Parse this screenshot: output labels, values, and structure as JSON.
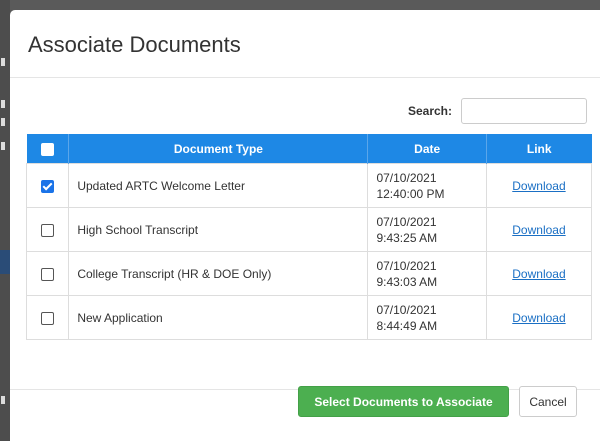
{
  "modal": {
    "title": "Associate Documents"
  },
  "search": {
    "label": "Search:",
    "value": "",
    "placeholder": ""
  },
  "table": {
    "headers": {
      "select_all_checked": false,
      "document_type": "Document Type",
      "date": "Date",
      "link": "Link"
    },
    "rows": [
      {
        "checked": true,
        "document_type": "Updated ARTC Welcome Letter",
        "date_line1": "07/10/2021",
        "date_line2": "12:40:00 PM",
        "link": "Download"
      },
      {
        "checked": false,
        "document_type": "High School Transcript",
        "date_line1": "07/10/2021",
        "date_line2": "9:43:25 AM",
        "link": "Download"
      },
      {
        "checked": false,
        "document_type": "College Transcript (HR & DOE Only)",
        "date_line1": "07/10/2021",
        "date_line2": "9:43:03 AM",
        "link": "Download"
      },
      {
        "checked": false,
        "document_type": "New Application",
        "date_line1": "07/10/2021",
        "date_line2": "8:44:49 AM",
        "link": "Download"
      }
    ]
  },
  "footer": {
    "primary_label": "Select Documents to Associate",
    "cancel_label": "Cancel"
  },
  "colors": {
    "header_blue": "#1e88e5",
    "primary_green": "#4caf50",
    "link_blue": "#1a6fc4",
    "checkbox_blue": "#1a73e8"
  }
}
